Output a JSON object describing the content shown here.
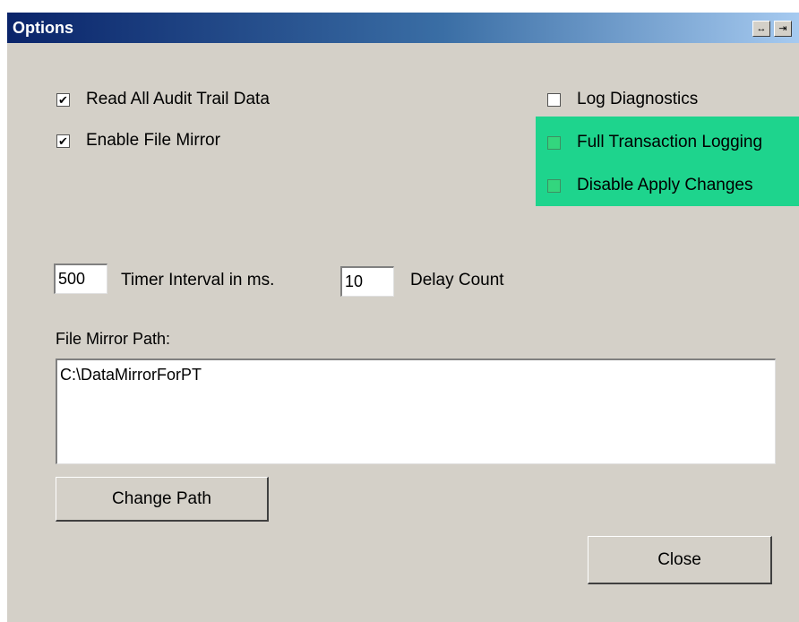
{
  "window": {
    "title": "Options",
    "title_buttons": {
      "pin": "↔",
      "float": "⇥"
    }
  },
  "options": {
    "read_all_audit": {
      "label": "Read All Audit Trail Data",
      "checked": true
    },
    "enable_file_mirror": {
      "label": "Enable File Mirror",
      "checked": true
    },
    "log_diagnostics": {
      "label": "Log Diagnostics",
      "checked": false
    },
    "full_transaction_logging": {
      "label": "Full Transaction Logging",
      "checked": false
    },
    "disable_apply_changes": {
      "label": "Disable Apply Changes",
      "checked": false
    }
  },
  "timer": {
    "value": "500",
    "label": "Timer Interval in ms."
  },
  "delay": {
    "value": "10",
    "label": "Delay Count"
  },
  "file_mirror": {
    "label": "File Mirror Path:",
    "path": "C:\\DataMirrorForPT"
  },
  "buttons": {
    "change_path": "Change Path",
    "close": "Close"
  },
  "colors": {
    "highlight": "#1ed48d",
    "green_checkbox": "#33d67e",
    "window_bg": "#d4d0c8"
  },
  "check_glyph": "✔"
}
